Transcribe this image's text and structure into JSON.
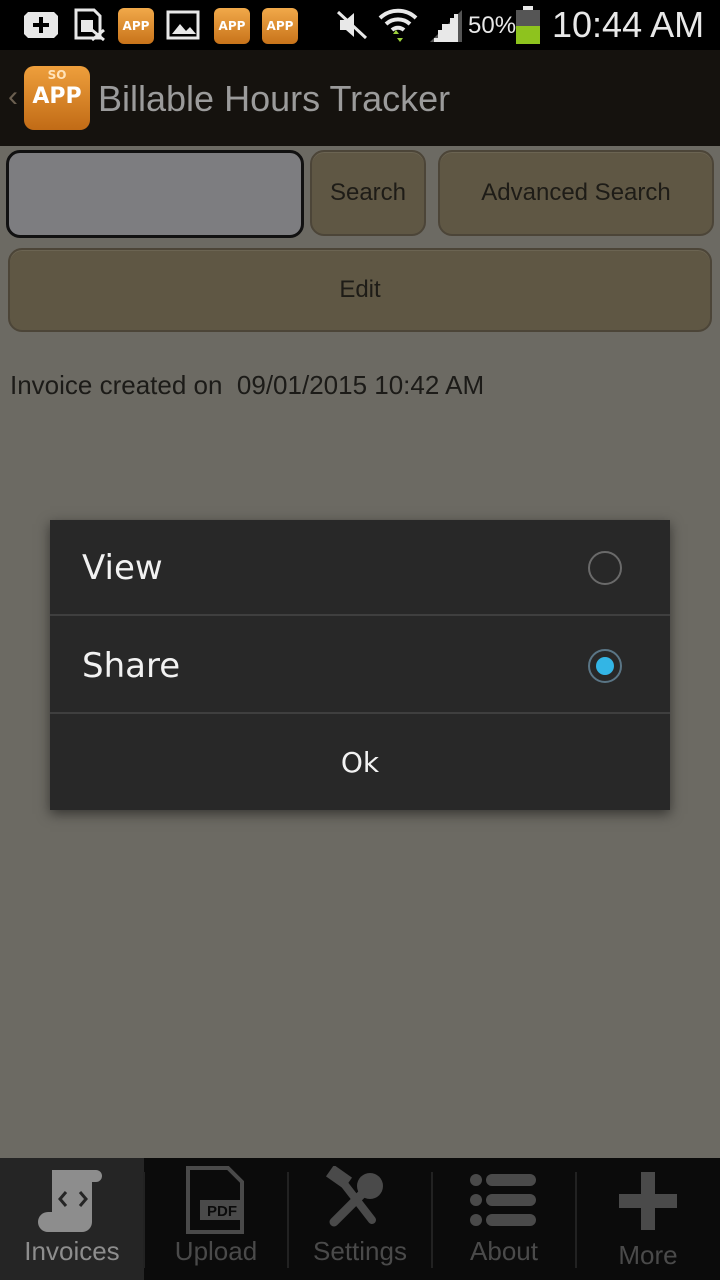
{
  "status_bar": {
    "icons": [
      "add-icon",
      "sim-off-icon",
      "app-icon",
      "image-icon",
      "app-icon",
      "app-icon",
      "mute-icon",
      "wifi-icon",
      "signal-icon",
      "battery-icon"
    ],
    "app_icon_text": "APP",
    "battery_percent": "50%",
    "time": "10:44 AM"
  },
  "header": {
    "logo_top": "SO",
    "logo_main": "APP",
    "title": "Billable Hours Tracker"
  },
  "search": {
    "input_value": "",
    "search_label": "Search",
    "advanced_label": "Advanced Search"
  },
  "edit_label": "Edit",
  "invoice_text": "Invoice created on  09/01/2015 10:42 AM",
  "dialog": {
    "options": [
      {
        "label": "View",
        "selected": false
      },
      {
        "label": "Share",
        "selected": true
      }
    ],
    "ok_label": "Ok"
  },
  "tabs": [
    {
      "label": "Invoices",
      "icon": "script-icon",
      "active": true
    },
    {
      "label": "Upload",
      "icon": "pdf-icon",
      "active": false
    },
    {
      "label": "Settings",
      "icon": "tools-icon",
      "active": false
    },
    {
      "label": "About",
      "icon": "list-icon",
      "active": false
    },
    {
      "label": "More",
      "icon": "plus-icon",
      "active": false
    }
  ],
  "colors": {
    "accent_radio": "#33b5e5",
    "content_bg": "#6c6a63",
    "button_bg": "#5f5744",
    "dialog_bg": "#282828"
  }
}
